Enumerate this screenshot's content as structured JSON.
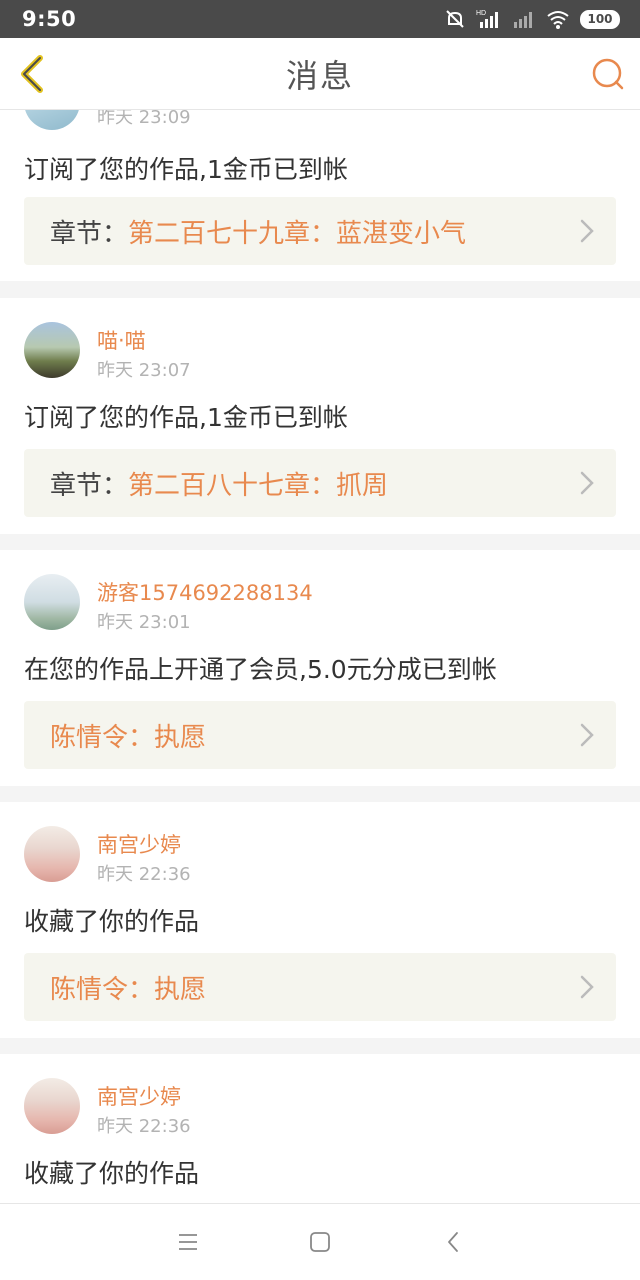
{
  "status": {
    "time": "9:50",
    "battery": "100",
    "hd_label": "HD"
  },
  "nav": {
    "title": "消息"
  },
  "messages": [
    {
      "username": "",
      "time": "昨天 23:09",
      "action": "订阅了您的作品,1金币已到帐",
      "link_prefix": "章节：",
      "link_title": "第二百七十九章：蓝湛变小气"
    },
    {
      "username": "喵‧喵",
      "time": "昨天 23:07",
      "action": "订阅了您的作品,1金币已到帐",
      "link_prefix": "章节：",
      "link_title": "第二百八十七章：抓周"
    },
    {
      "username": "游客1574692288134",
      "time": "昨天 23:01",
      "action": "在您的作品上开通了会员,5.0元分成已到帐",
      "link_prefix": "",
      "link_title": "陈情令：执愿"
    },
    {
      "username": "南宫少婷",
      "time": "昨天 22:36",
      "action": "收藏了你的作品",
      "link_prefix": "",
      "link_title": "陈情令：执愿"
    },
    {
      "username": "南宫少婷",
      "time": "昨天 22:36",
      "action": "收藏了你的作品",
      "link_prefix": "",
      "link_title": ""
    }
  ],
  "colors": {
    "accent": "#e8894e",
    "back_arrow": "#e2c21f",
    "link_bg": "#f5f5ee"
  },
  "icons": {
    "back": "back-arrow-icon",
    "search": "search-icon",
    "chevron": "chevron-right-icon",
    "menu": "menu-icon",
    "home": "home-square-icon",
    "system_back": "system-back-icon"
  }
}
